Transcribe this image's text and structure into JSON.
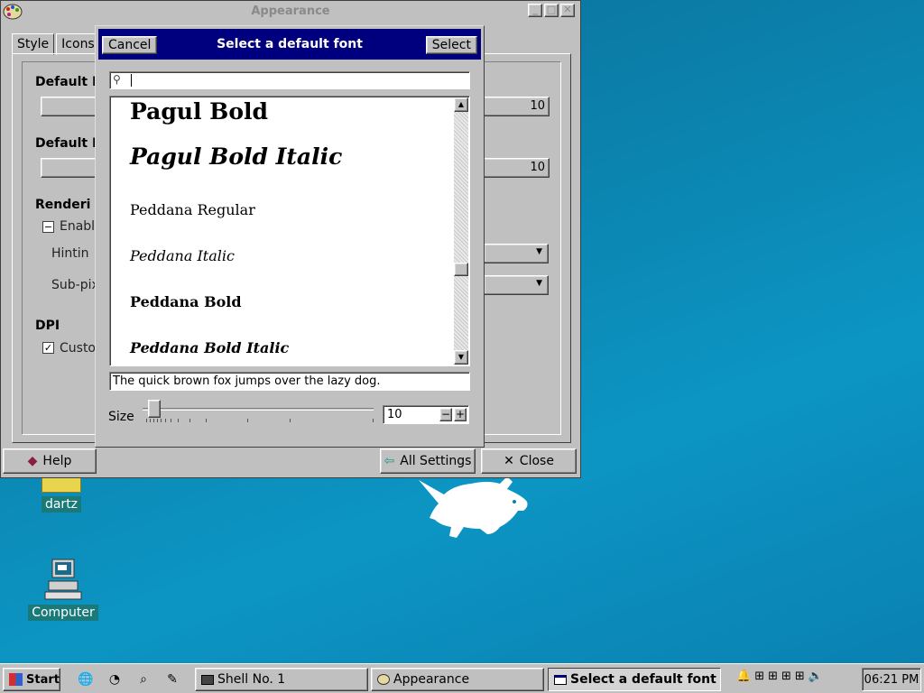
{
  "desktop": {
    "icons": [
      {
        "label": "dartz"
      },
      {
        "label": "Computer"
      }
    ]
  },
  "appearance": {
    "title": "Appearance",
    "tabs": [
      "Style",
      "Icons"
    ],
    "default_font_label": "Default F",
    "default_font_size": "10",
    "default_mono_label": "Default M",
    "default_mono_size": "10",
    "rendering_label": "Renderi",
    "enable_label": "Enabl",
    "hinting_label": "Hintin",
    "subpixel_label": "Sub-pix",
    "dpi_label": "DPI",
    "custom_label": "Custo",
    "help_button": "Help",
    "all_settings_button": "All Settings",
    "close_button": "Close"
  },
  "dialog": {
    "title": "Select a default font",
    "cancel_button": "Cancel",
    "select_button": "Select",
    "search_value": "",
    "fonts": [
      {
        "name": "Pagul Bold"
      },
      {
        "name": "Pagul Bold Italic"
      },
      {
        "name": "Peddana Regular"
      },
      {
        "name": "Peddana Italic"
      },
      {
        "name": "Peddana Bold"
      },
      {
        "name": "Peddana Bold Italic"
      }
    ],
    "preview_text": "The quick brown fox jumps over the lazy dog.",
    "size_label": "Size",
    "size_value": "10"
  },
  "taskbar": {
    "start_label": "Start",
    "tasks": [
      {
        "label": "Shell No. 1"
      },
      {
        "label": "Appearance"
      },
      {
        "label": "Select a default font"
      }
    ],
    "clock": "06:21 PM"
  }
}
